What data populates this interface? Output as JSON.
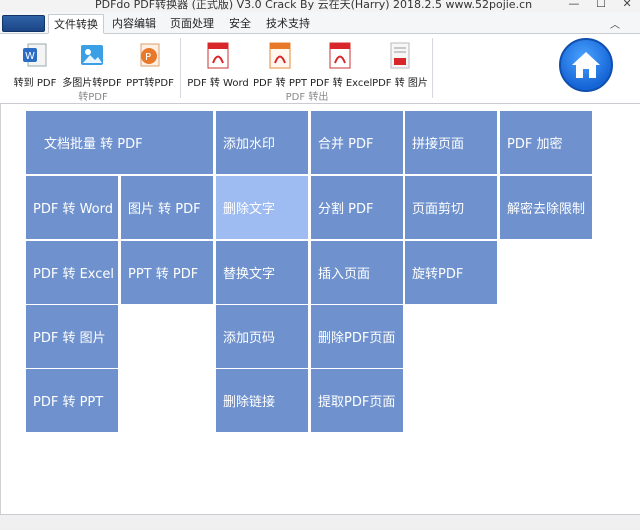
{
  "window": {
    "title": "PDFdo PDF转换器 (正式版) V3.0 Crack By 云在天(Harry) 2018.2.5 www.52pojie.cn",
    "minimize": "—",
    "maximize": "☐",
    "close": "✕"
  },
  "tabs": [
    {
      "label": "文件转换",
      "active": true
    },
    {
      "label": "内容编辑",
      "active": false
    },
    {
      "label": "页面处理",
      "active": false
    },
    {
      "label": "安全",
      "active": false
    },
    {
      "label": "技术支持",
      "active": false
    }
  ],
  "collapse_glyph": "︿",
  "ribbon": {
    "buttons": [
      {
        "label": "转到 PDF",
        "icon": "word-to-pdf-icon"
      },
      {
        "label": "多图片转PDF",
        "icon": "image-to-pdf-icon"
      },
      {
        "label": "PPT转PDF",
        "icon": "ppt-to-pdf-icon"
      },
      {
        "label": "PDF 转 Word",
        "icon": "pdf-to-word-icon"
      },
      {
        "label": "PDF 转 PPT",
        "icon": "pdf-to-ppt-icon"
      },
      {
        "label": "PDF 转 Excel",
        "icon": "pdf-to-excel-icon"
      },
      {
        "label": "PDF 转 图片",
        "icon": "pdf-to-image-icon"
      }
    ],
    "groups": [
      "转PDF",
      "PDF 转出"
    ]
  },
  "colors": {
    "tile": "#6f92ce",
    "tile_highlight": "#9ebcf1",
    "home_button": "#1665d6"
  },
  "tiles": {
    "batch": "文档批量 转 PDF",
    "watermark": "添加水印",
    "merge": "合并 PDF",
    "join_pages": "拼接页面",
    "encrypt": "PDF 加密",
    "to_word": "PDF 转 Word",
    "image_to_pdf": "图片 转 PDF",
    "delete_text": "删除文字",
    "split": "分割 PDF",
    "crop": "页面剪切",
    "decrypt": "解密去除限制",
    "to_excel": "PDF 转 Excel",
    "ppt_to_pdf": "PPT 转 PDF",
    "replace_text": "替换文字",
    "insert_page": "插入页面",
    "rotate": "旋转PDF",
    "to_image": "PDF 转 图片",
    "page_number": "添加页码",
    "delete_pages": "删除PDF页面",
    "to_ppt": "PDF 转 PPT",
    "delete_links": "删除链接",
    "extract_pages": "提取PDF页面"
  }
}
